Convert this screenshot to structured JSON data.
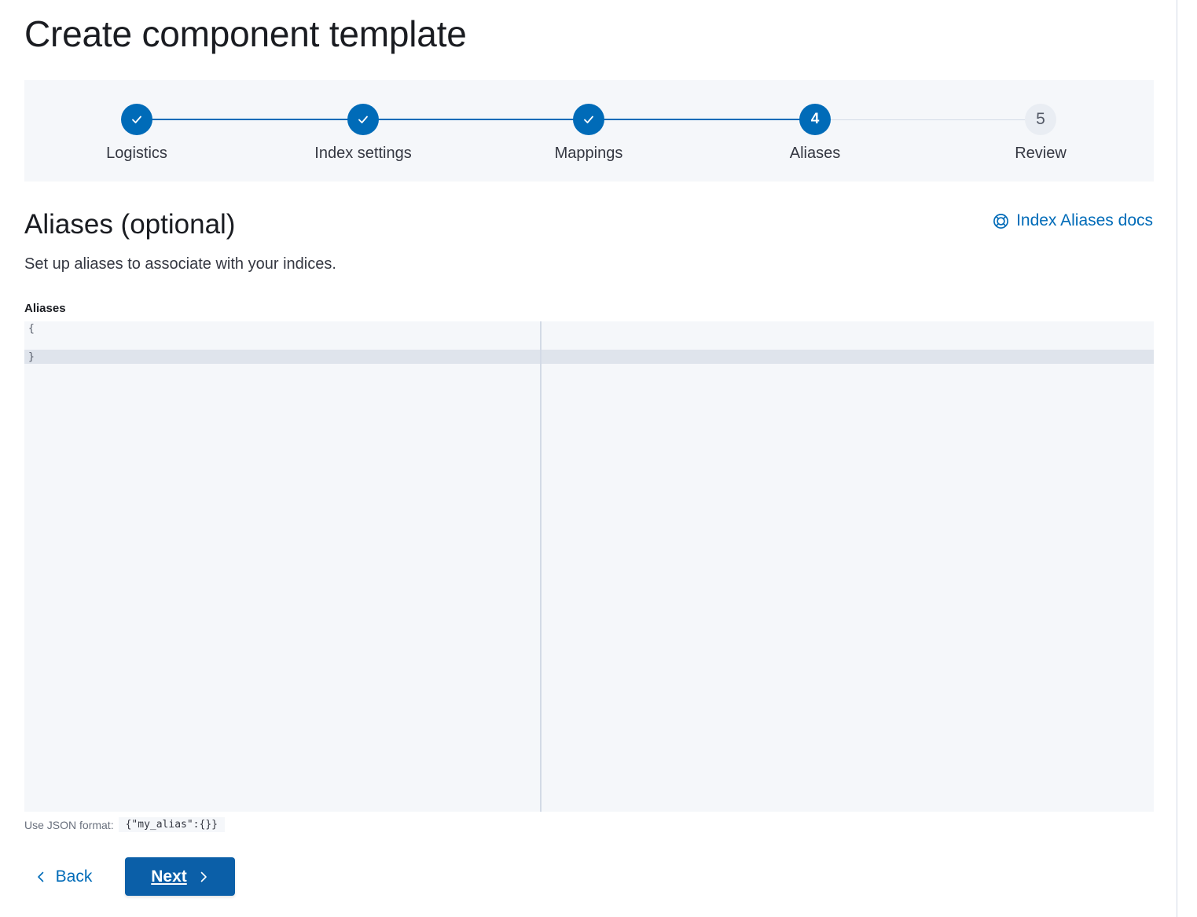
{
  "page": {
    "title": "Create component template"
  },
  "steps": [
    {
      "title": "Logistics",
      "status": "complete",
      "icon": "check-icon"
    },
    {
      "title": "Index settings",
      "status": "complete",
      "icon": "check-icon"
    },
    {
      "title": "Mappings",
      "status": "complete",
      "icon": "check-icon"
    },
    {
      "title": "Aliases",
      "status": "current",
      "number": "4"
    },
    {
      "title": "Review",
      "status": "incomplete",
      "number": "5"
    }
  ],
  "section": {
    "title": "Aliases (optional)",
    "description": "Set up aliases to associate with your indices.",
    "docs_link": {
      "label": "Index Aliases docs",
      "icon": "help-lifebuoy-icon"
    }
  },
  "editor": {
    "label": "Aliases",
    "lines": [
      "{",
      "",
      "}"
    ]
  },
  "help": {
    "prefix": "Use JSON format:",
    "example": "{\"my_alias\":{}}"
  },
  "footer": {
    "back_label": "Back",
    "next_label": "Next"
  },
  "colors": {
    "primary": "#006bb8",
    "button": "#0b5fa8",
    "panel": "#f5f7fa"
  }
}
